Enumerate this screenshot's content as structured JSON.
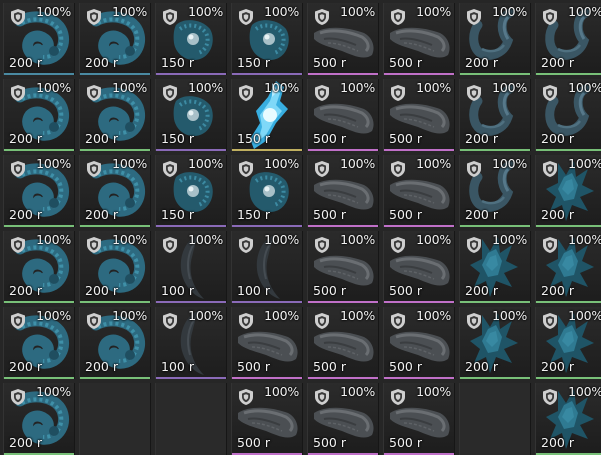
{
  "items": [
    {
      "row": 0,
      "col": 0,
      "kind": "crystal-ring",
      "durability": "100%",
      "price": "200 r",
      "accent": "#4a8aa2"
    },
    {
      "row": 0,
      "col": 1,
      "kind": "crystal-ring",
      "durability": "100%",
      "price": "200 r",
      "accent": "#4a8aa2"
    },
    {
      "row": 0,
      "col": 2,
      "kind": "orb",
      "durability": "100%",
      "price": "150 r",
      "accent": "#8a6ab8"
    },
    {
      "row": 0,
      "col": 3,
      "kind": "orb",
      "durability": "100%",
      "price": "150 r",
      "accent": "#8a6ab8"
    },
    {
      "row": 0,
      "col": 4,
      "kind": "rock-slab",
      "durability": "100%",
      "price": "500 r",
      "accent": "#c070c8"
    },
    {
      "row": 0,
      "col": 5,
      "kind": "rock-slab",
      "durability": "100%",
      "price": "500 r",
      "accent": "#c070c8"
    },
    {
      "row": 0,
      "col": 6,
      "kind": "hook",
      "durability": "100%",
      "price": "200 r",
      "accent": "#78c078"
    },
    {
      "row": 0,
      "col": 7,
      "kind": "hook",
      "durability": "100%",
      "price": "200 r",
      "accent": "#78c078"
    },
    {
      "row": 1,
      "col": 0,
      "kind": "crystal-ring",
      "durability": "100%",
      "price": "200 r",
      "accent": "#78c078"
    },
    {
      "row": 1,
      "col": 1,
      "kind": "crystal-ring",
      "durability": "100%",
      "price": "200 r",
      "accent": "#78c078"
    },
    {
      "row": 1,
      "col": 2,
      "kind": "orb",
      "durability": "100%",
      "price": "150 r",
      "accent": "#8a6ab8"
    },
    {
      "row": 1,
      "col": 3,
      "kind": "glow-crystal",
      "durability": "100%",
      "price": "150 r",
      "accent": "#c0b060"
    },
    {
      "row": 1,
      "col": 4,
      "kind": "rock-slab",
      "durability": "100%",
      "price": "500 r",
      "accent": "#c070c8"
    },
    {
      "row": 1,
      "col": 5,
      "kind": "rock-slab",
      "durability": "100%",
      "price": "500 r",
      "accent": "#c070c8"
    },
    {
      "row": 1,
      "col": 6,
      "kind": "hook",
      "durability": "100%",
      "price": "200 r",
      "accent": "#78c078"
    },
    {
      "row": 1,
      "col": 7,
      "kind": "hook",
      "durability": "100%",
      "price": "200 r",
      "accent": "#78c078"
    },
    {
      "row": 2,
      "col": 0,
      "kind": "crystal-ring",
      "durability": "100%",
      "price": "200 r",
      "accent": "#78c078"
    },
    {
      "row": 2,
      "col": 1,
      "kind": "crystal-ring",
      "durability": "100%",
      "price": "200 r",
      "accent": "#78c078"
    },
    {
      "row": 2,
      "col": 2,
      "kind": "orb",
      "durability": "100%",
      "price": "150 r",
      "accent": "#8a6ab8"
    },
    {
      "row": 2,
      "col": 3,
      "kind": "orb",
      "durability": "100%",
      "price": "150 r",
      "accent": "#8a6ab8"
    },
    {
      "row": 2,
      "col": 4,
      "kind": "rock-slab",
      "durability": "100%",
      "price": "500 r",
      "accent": "#c070c8"
    },
    {
      "row": 2,
      "col": 5,
      "kind": "rock-slab",
      "durability": "100%",
      "price": "500 r",
      "accent": "#c070c8"
    },
    {
      "row": 2,
      "col": 6,
      "kind": "hook",
      "durability": "100%",
      "price": "200 r",
      "accent": "#78c078"
    },
    {
      "row": 2,
      "col": 7,
      "kind": "spiked-shard",
      "durability": "100%",
      "price": "200 r",
      "accent": "#78c078"
    },
    {
      "row": 3,
      "col": 0,
      "kind": "crystal-ring",
      "durability": "100%",
      "price": "200 r",
      "accent": "#78c078"
    },
    {
      "row": 3,
      "col": 1,
      "kind": "crystal-ring",
      "durability": "100%",
      "price": "200 r",
      "accent": "#78c078"
    },
    {
      "row": 3,
      "col": 2,
      "kind": "crescent",
      "durability": "100%",
      "price": "100 r",
      "accent": "#8a6ab8"
    },
    {
      "row": 3,
      "col": 3,
      "kind": "crescent",
      "durability": "100%",
      "price": "100 r",
      "accent": "#8a6ab8"
    },
    {
      "row": 3,
      "col": 4,
      "kind": "rock-slab",
      "durability": "100%",
      "price": "500 r",
      "accent": "#c070c8"
    },
    {
      "row": 3,
      "col": 5,
      "kind": "rock-slab",
      "durability": "100%",
      "price": "500 r",
      "accent": "#c070c8"
    },
    {
      "row": 3,
      "col": 6,
      "kind": "spiked-shard",
      "durability": "100%",
      "price": "200 r",
      "accent": "#78c078"
    },
    {
      "row": 3,
      "col": 7,
      "kind": "spiked-shard",
      "durability": "100%",
      "price": "200 r",
      "accent": "#78c078"
    },
    {
      "row": 4,
      "col": 0,
      "kind": "crystal-ring",
      "durability": "100%",
      "price": "200 r",
      "accent": "#78c078"
    },
    {
      "row": 4,
      "col": 1,
      "kind": "crystal-ring",
      "durability": "100%",
      "price": "200 r",
      "accent": "#78c078"
    },
    {
      "row": 4,
      "col": 2,
      "kind": "crescent",
      "durability": "100%",
      "price": "100 r",
      "accent": "#8a6ab8"
    },
    {
      "row": 4,
      "col": 3,
      "kind": "rock-slab",
      "durability": "100%",
      "price": "500 r",
      "accent": "#c070c8"
    },
    {
      "row": 4,
      "col": 4,
      "kind": "rock-slab",
      "durability": "100%",
      "price": "500 r",
      "accent": "#c070c8"
    },
    {
      "row": 4,
      "col": 5,
      "kind": "rock-slab",
      "durability": "100%",
      "price": "500 r",
      "accent": "#c070c8"
    },
    {
      "row": 4,
      "col": 6,
      "kind": "spiked-shard",
      "durability": "100%",
      "price": "200 r",
      "accent": "#78c078"
    },
    {
      "row": 4,
      "col": 7,
      "kind": "spiked-shard",
      "durability": "100%",
      "price": "200 r",
      "accent": "#78c078"
    },
    {
      "row": 5,
      "col": 0,
      "kind": "crystal-ring",
      "durability": "100%",
      "price": "200 r",
      "accent": "#78c078"
    },
    {
      "row": 5,
      "col": 1,
      "kind": "empty"
    },
    {
      "row": 5,
      "col": 2,
      "kind": "empty"
    },
    {
      "row": 5,
      "col": 3,
      "kind": "rock-slab",
      "durability": "100%",
      "price": "500 r",
      "accent": "#c070c8"
    },
    {
      "row": 5,
      "col": 4,
      "kind": "rock-slab",
      "durability": "100%",
      "price": "500 r",
      "accent": "#c070c8"
    },
    {
      "row": 5,
      "col": 5,
      "kind": "rock-slab",
      "durability": "100%",
      "price": "500 r",
      "accent": "#c070c8"
    },
    {
      "row": 5,
      "col": 6,
      "kind": "empty"
    },
    {
      "row": 5,
      "col": 7,
      "kind": "spiked-shard",
      "durability": "100%",
      "price": "200 r",
      "accent": "#78c078"
    }
  ],
  "icon": "shield-icon",
  "colors": {
    "background": "#262626",
    "text": "#f2f2f2",
    "teal": "#2e6f86",
    "rock": "#55585c"
  }
}
